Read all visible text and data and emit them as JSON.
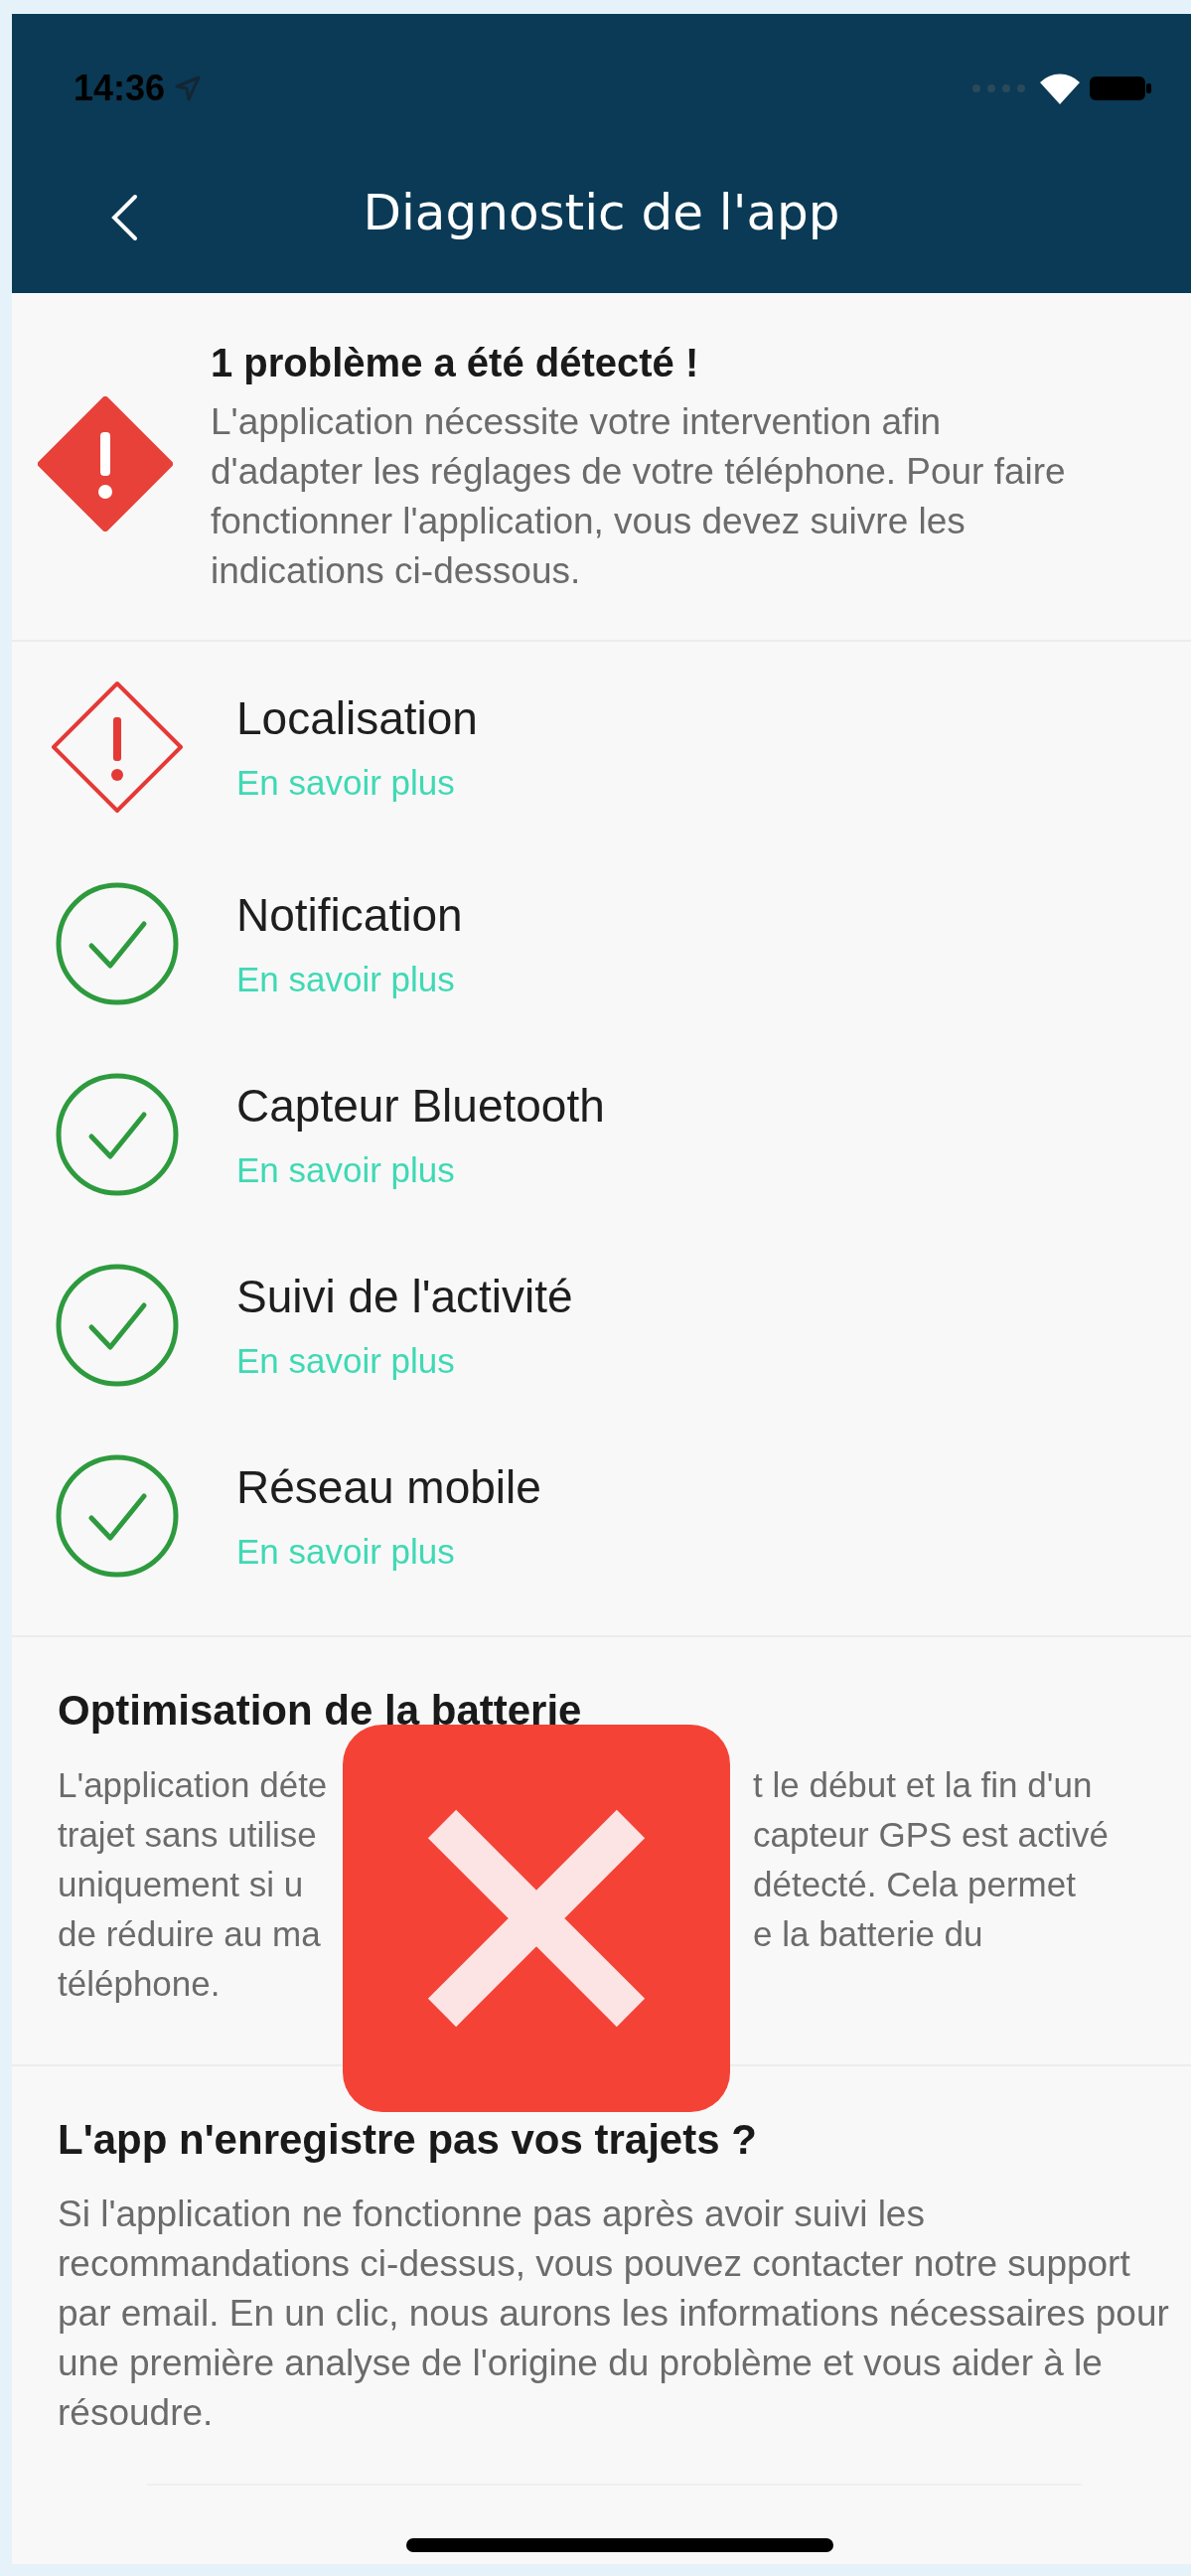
{
  "status_bar": {
    "time": "14:36"
  },
  "header": {
    "title": "Diagnostic de l'app"
  },
  "alert": {
    "title": "1 problème a été détecté !",
    "text": "L'application nécessite votre intervention afin d'adapter les réglages de votre téléphone. Pour faire fonctionner l'application, vous devez suivre les indications ci-dessous."
  },
  "checks": [
    {
      "kind": "warning",
      "label": "Localisation",
      "link": "En savoir plus"
    },
    {
      "kind": "ok",
      "label": "Notification",
      "link": "En savoir plus"
    },
    {
      "kind": "ok",
      "label": "Capteur Bluetooth",
      "link": "En savoir plus"
    },
    {
      "kind": "ok",
      "label": "Suivi de l'activité",
      "link": "En savoir plus"
    },
    {
      "kind": "ok",
      "label": "Réseau mobile",
      "link": "En savoir plus"
    }
  ],
  "battery": {
    "title": "Optimisation de la batterie",
    "lines": [
      {
        "left": "L'application déte",
        "right": "t le début et la fin d'un"
      },
      {
        "left": "trajet sans utilise",
        "right": "capteur GPS est activé"
      },
      {
        "left": "uniquement si u",
        "right": "détecté. Cela permet"
      },
      {
        "left": "de réduire au ma",
        "right": "e la batterie du"
      },
      {
        "left": "téléphone."
      }
    ]
  },
  "support": {
    "title": "L'app n'enregistre pas vos trajets ?",
    "text": "Si l'application ne fonctionne pas après avoir suivi les recommandations ci-dessus, vous pouvez contacter notre support par email. En un clic, nous aurons les informations nécessaires pour une première analyse de l'origine du problème et vous aider à le résoudre."
  }
}
